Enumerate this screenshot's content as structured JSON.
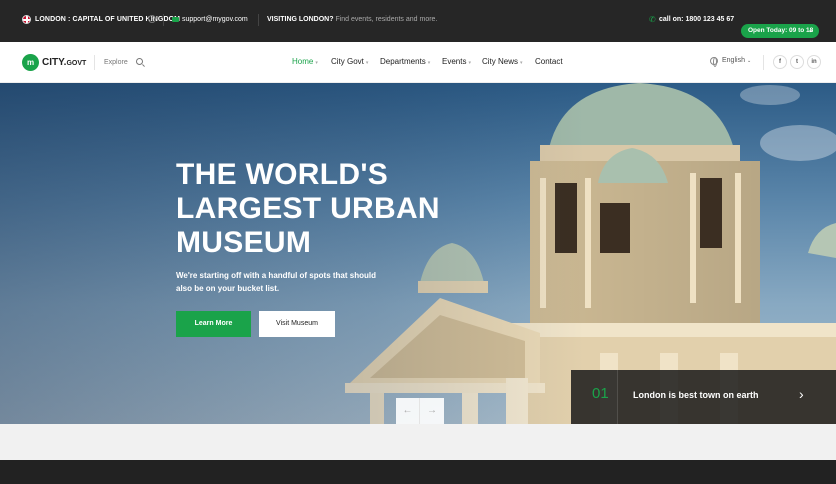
{
  "topbar": {
    "location": "LONDON : CAPITAL OF UNITED KINGDOM",
    "email": "support@mygov.com",
    "visiting_label": "VISITING LONDON?",
    "visiting_text": "Find events, residents and more.",
    "phone": "call on: 1800 123 45 67",
    "open_today": "Open Today: 09 to 18"
  },
  "navbar": {
    "logo_prefix": "CITY.",
    "logo_suffix": "GOVT",
    "explore": "Explore",
    "menu": [
      {
        "label": "Home"
      },
      {
        "label": "City Govt"
      },
      {
        "label": "Departments"
      },
      {
        "label": "Events"
      },
      {
        "label": "City News"
      },
      {
        "label": "Contact"
      }
    ],
    "language": "English",
    "social": [
      "f",
      "t",
      "in"
    ]
  },
  "hero": {
    "title_line1": "THE WORLD'S",
    "title_line2": "LARGEST URBAN",
    "title_line3": "MUSEUM",
    "subtitle": "We're starting off with a handful of spots that should also be on your bucket list.",
    "learn_more": "Learn More",
    "visit_museum": "Visit Museum",
    "slide_prev": "←",
    "slide_next": "→",
    "caption_number": "01",
    "caption_text": "London is best town on earth",
    "caption_arrow": "›"
  },
  "colors": {
    "accent": "#1aa34a",
    "topbar_bg": "#262626"
  }
}
